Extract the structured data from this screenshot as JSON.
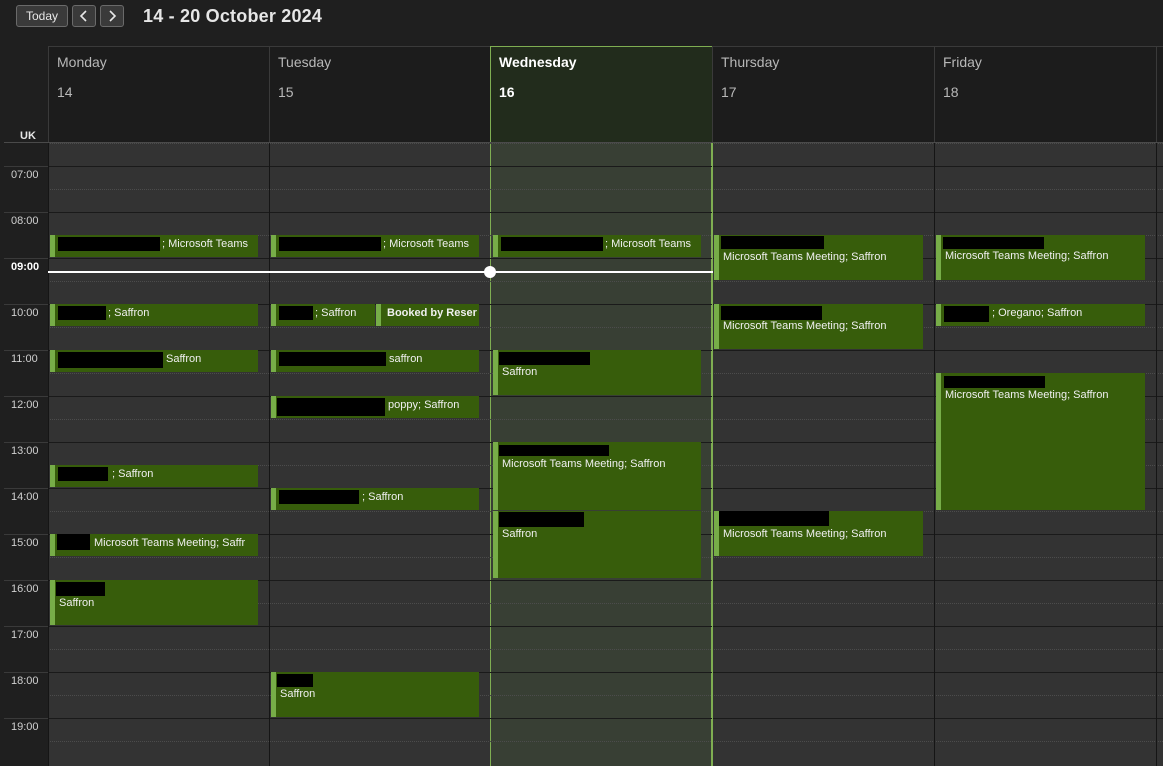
{
  "toolbar": {
    "today_label": "Today",
    "range_title": "14 - 20 October 2024"
  },
  "timezone_label": "UK",
  "days": [
    {
      "name": "Monday",
      "date": "14"
    },
    {
      "name": "Tuesday",
      "date": "15"
    },
    {
      "name": "Wednesday",
      "date": "16"
    },
    {
      "name": "Thursday",
      "date": "17"
    },
    {
      "name": "Friday",
      "date": "18"
    }
  ],
  "today_index": 2,
  "hours": [
    "07:00",
    "08:00",
    "09:00",
    "10:00",
    "11:00",
    "12:00",
    "13:00",
    "14:00",
    "15:00",
    "16:00",
    "17:00",
    "18:00",
    "19:00"
  ],
  "current_hour_label": "09:00",
  "colors": {
    "event_bg": "#375d0b",
    "event_accent": "#77ad48",
    "today_border": "#7fae52",
    "redaction": "#000000"
  },
  "events": {
    "mon_0815": "; Microsoft Teams",
    "mon_1000": "; Saffron",
    "mon_1100": "Saffron",
    "mon_1330": "; Saffron",
    "mon_1500": "Microsoft Teams Meeting; Saffr",
    "mon_1600": "Saffron",
    "tue_0815": "; Microsoft Teams",
    "tue_1000": "; Saffron",
    "tue_1000b": "Booked by Reser",
    "tue_1100": "saffron",
    "tue_1200": "poppy; Saffron",
    "tue_1400": "; Saffron",
    "tue_1800": "Saffron",
    "wed_0815": "; Microsoft Teams",
    "wed_1100": "Saffron",
    "wed_1300": "Microsoft Teams Meeting; Saffron",
    "wed_1430": "Saffron",
    "thu_0830": "Microsoft Teams Meeting; Saffron",
    "thu_1000": "Microsoft Teams Meeting; Saffron",
    "thu_1430": "Microsoft Teams Meeting; Saffron",
    "fri_0830": "Microsoft Teams Meeting; Saffron",
    "fri_1000": "; Oregano; Saffron",
    "fri_1130": "Microsoft Teams Meeting; Saffron"
  }
}
